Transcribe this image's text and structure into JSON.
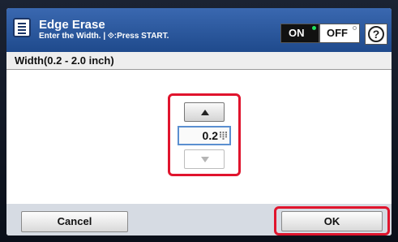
{
  "header": {
    "title": "Edge Erase",
    "subtitle": "Enter the Width. | ⟐:Press START.",
    "on_label": "ON",
    "off_label": "OFF",
    "help_label": "?"
  },
  "field": {
    "label": "Width(0.2 - 2.0 inch)",
    "value": "0.2"
  },
  "footer": {
    "cancel_label": "Cancel",
    "ok_label": "OK"
  },
  "icons": [
    "menu-icon",
    "help-icon",
    "up-arrow-icon",
    "down-arrow-icon",
    "keypad-icon"
  ],
  "colors": {
    "header": "#2b5aa0",
    "highlight": "#e0142d",
    "power_on_indicator": "#20e060"
  }
}
